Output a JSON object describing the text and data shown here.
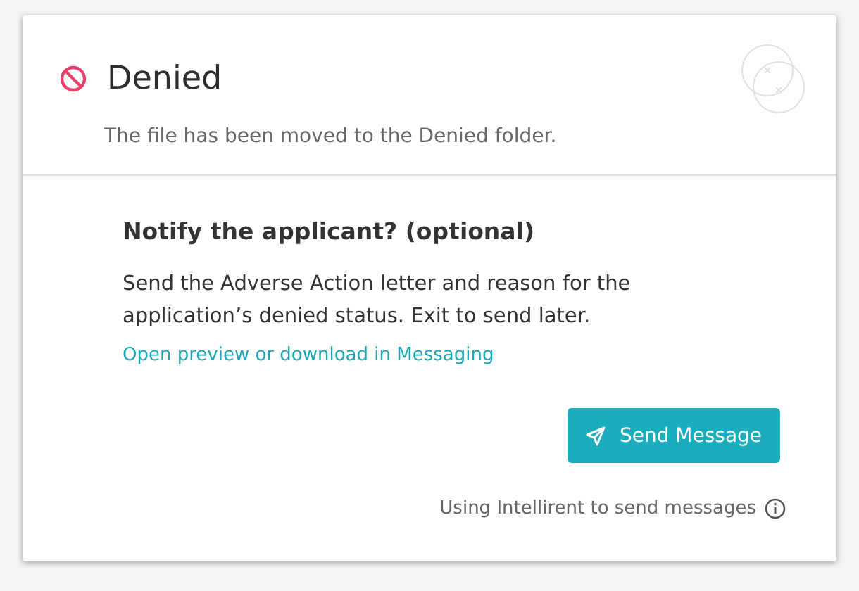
{
  "header": {
    "title": "Denied",
    "subtitle": "The file has been moved to the Denied folder."
  },
  "body": {
    "heading": "Notify the applicant? (optional)",
    "text": "Send the Adverse Action letter and reason for the application’s denied status. Exit to send later.",
    "link": "Open preview or download in Messaging"
  },
  "send_button": {
    "label": "Send Message"
  },
  "footer_note": "Using Intellirent to send messages"
}
